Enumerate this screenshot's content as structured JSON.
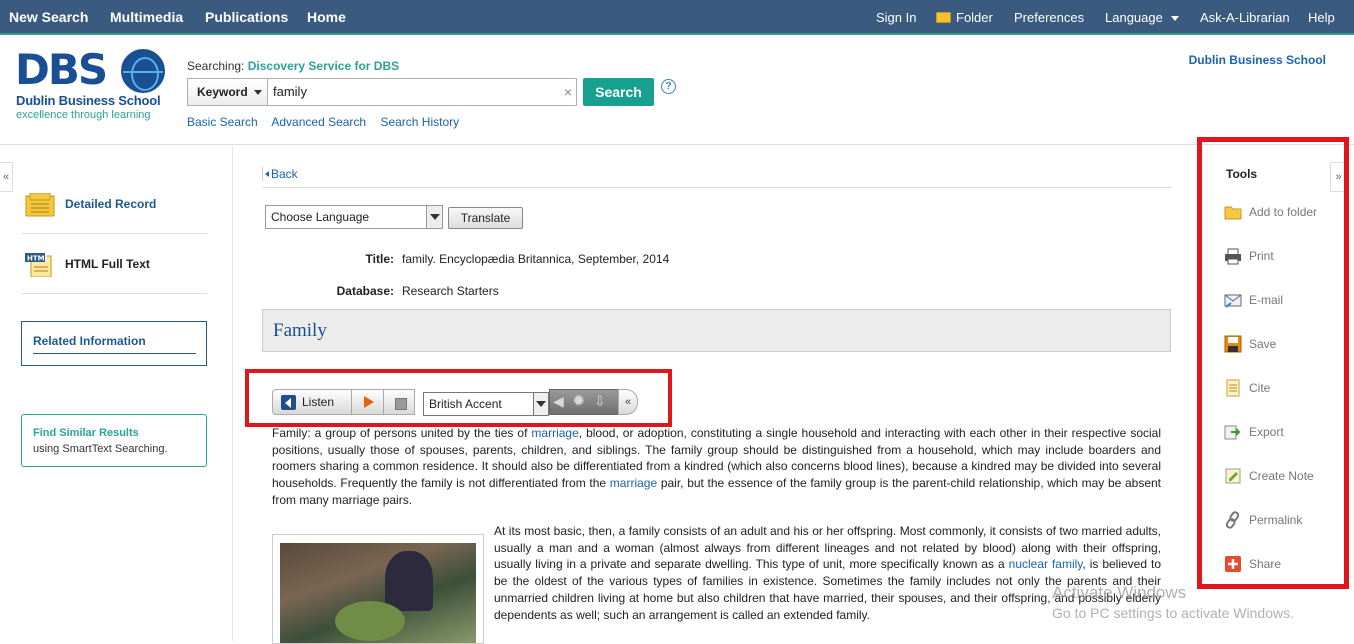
{
  "topbar": {
    "new_search": "New Search",
    "multimedia": "Multimedia",
    "publications": "Publications",
    "home": "Home",
    "sign_in": "Sign In",
    "folder": "Folder",
    "preferences": "Preferences",
    "language": "Language",
    "ask": "Ask-A-Librarian",
    "help": "Help"
  },
  "header": {
    "logo_text": "DBS",
    "logo_name": "Dublin Business School",
    "logo_tagline": "excellence through learning",
    "searching_label": "Searching:",
    "searching_source": "Discovery Service for DBS",
    "field_select": "Keyword",
    "query": "family",
    "clear": "×",
    "search_button": "Search",
    "help_icon": "?",
    "basic_search": "Basic Search",
    "advanced_search": "Advanced Search",
    "search_history": "Search History",
    "institution": "Dublin Business School"
  },
  "left": {
    "collapse": "«",
    "detailed_record": "Detailed Record",
    "html_full_text": "HTML Full Text",
    "related_information": "Related Information",
    "find_similar": "Find Similar Results",
    "find_similar_sub": "using SmartText Searching."
  },
  "main": {
    "back": "Back",
    "choose_language": "Choose Language",
    "translate": "Translate",
    "title_label": "Title:",
    "title_value": "family. Encyclopædia Britannica, September, 2014",
    "database_label": "Database:",
    "database_value": "Research Starters",
    "article_title": "Family"
  },
  "player": {
    "listen": "Listen",
    "accent": "British Accent",
    "collapse": "«"
  },
  "article": {
    "p1_a": "Family: a group of persons united by the ties of ",
    "p1_link1": "marriage",
    "p1_b": ", blood, or adoption, constituting a single household and interacting with each other in their respective social positions, usually those of spouses, parents, children, and siblings. The family group should be distinguished from a household, which may include boarders and roomers sharing a common residence. It should also be differentiated from a kindred (which also concerns blood lines), because a kindred may be divided into several households. Frequently the family is not differentiated from the ",
    "p1_link2": "marriage",
    "p1_c": " pair, but the essence of the family group is the parent-child relationship, which may be absent from many marriage pairs.",
    "p2_a": "At its most basic, then, a family consists of an adult and his or her offspring. Most commonly, it consists of two married adults, usually a man and a woman (almost always from different lineages and not related by blood) along with their offspring, usually living in a private and separate dwelling. This type of unit, more specifically known as a ",
    "p2_link": "nuclear family",
    "p2_b": ", is believed to be the oldest of the various types of families in existence. Sometimes the family includes not only the parents and their unmarried children living at home but also children that have married, their spouses, and their offspring, and possibly elderly dependents as well; such an arrangement is called an extended family."
  },
  "tools": {
    "collapse": "»",
    "heading": "Tools",
    "items": [
      {
        "label": "Add to folder",
        "icon": "folder-icon"
      },
      {
        "label": "Print",
        "icon": "print-icon"
      },
      {
        "label": "E-mail",
        "icon": "email-icon"
      },
      {
        "label": "Save",
        "icon": "save-icon"
      },
      {
        "label": "Cite",
        "icon": "cite-icon"
      },
      {
        "label": "Export",
        "icon": "export-icon"
      },
      {
        "label": "Create Note",
        "icon": "note-icon"
      },
      {
        "label": "Permalink",
        "icon": "link-icon"
      },
      {
        "label": "Share",
        "icon": "share-icon"
      }
    ]
  },
  "watermark": {
    "line1": "Activate Windows",
    "line2": "Go to PC settings to activate Windows."
  },
  "colors": {
    "topbar": "#3a5a80",
    "accent_teal": "#17a08f",
    "link": "#1a63ad",
    "highlight_red": "#e0161c"
  }
}
